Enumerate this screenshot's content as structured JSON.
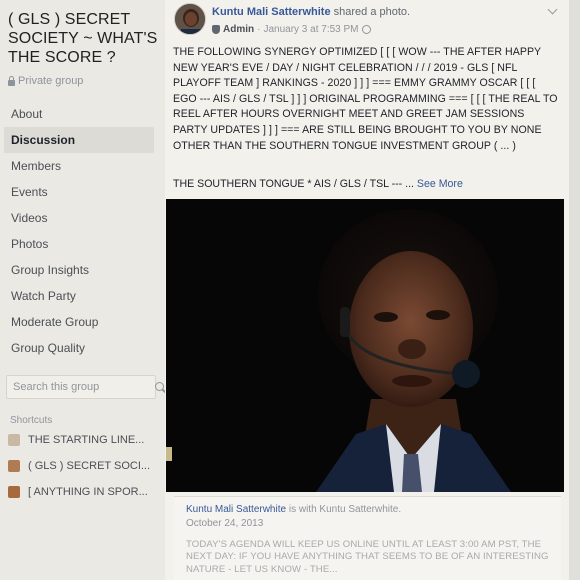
{
  "group": {
    "name": "( GLS ) SECRET SOCIETY ~ WHAT'S THE SCORE ?",
    "privacy": "Private group"
  },
  "nav": {
    "items": [
      {
        "label": "About"
      },
      {
        "label": "Discussion"
      },
      {
        "label": "Members"
      },
      {
        "label": "Events"
      },
      {
        "label": "Videos"
      },
      {
        "label": "Photos"
      },
      {
        "label": "Group Insights"
      },
      {
        "label": "Watch Party"
      },
      {
        "label": "Moderate Group"
      },
      {
        "label": "Group Quality"
      }
    ],
    "active": "Discussion"
  },
  "search": {
    "placeholder": "Search this group"
  },
  "shortcuts": {
    "title": "Shortcuts",
    "items": [
      {
        "label": "THE STARTING LINE...",
        "icon": "group-icon"
      },
      {
        "label": "( GLS ) SECRET SOCI...",
        "icon": "group-icon"
      },
      {
        "label": "[ ANYTHING IN SPOR...",
        "icon": "group-icon"
      }
    ]
  },
  "post": {
    "author": "Kuntu Mali Satterwhite",
    "action": "shared a photo.",
    "role": "Admin",
    "timestamp": "January 3 at 7:53 PM",
    "body": "THE FOLLOWING SYNERGY OPTIMIZED [ [ [ WOW --- THE AFTER HAPPY NEW YEAR'S EVE / DAY / NIGHT CELEBRATION / / / 2019 - GLS [ NFL PLAYOFF TEAM ] RANKINGS - 2020 ] ] ] === EMMY GRAMMY OSCAR [ [ [ EGO --- AIS / GLS / TSL ] ] ] ORIGINAL PROGRAMMING === [ [ [ THE REAL TO REEL AFTER HOURS OVERNIGHT MEET AND GREET JAM SESSIONS PARTY UPDATES ] ] ] === ARE STILL BEING BROUGHT TO YOU BY NONE OTHER THAN THE SOUTHERN TONGUE INVESTMENT GROUP ( ... )",
    "summary": "THE SOUTHERN TONGUE * AIS / GLS / TSL --- ...",
    "see_more": "See More"
  },
  "shared": {
    "author": "Kuntu Mali Satterwhite",
    "with_text": "is with",
    "with_person": "Kuntu Satterwhite.",
    "date": "October 24, 2013",
    "text": "TODAY'S AGENDA WILL KEEP US ONLINE UNTIL AT LEAST 3:00 AM PST, THE NEXT DAY: IF YOU HAVE ANYTHING THAT SEEMS TO BE OF AN INTERESTING NATURE - LET US KNOW - THE..."
  },
  "colors": {
    "link": "#385898",
    "muted": "#90949c",
    "sidebar_bg": "#ebe9e4",
    "post_bg": "#f3f1ec"
  }
}
